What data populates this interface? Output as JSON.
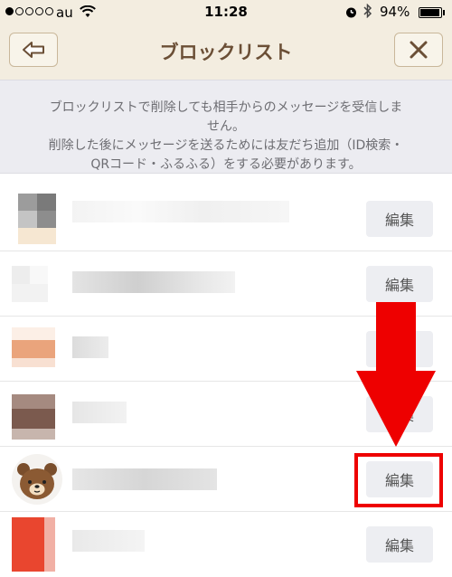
{
  "status_bar": {
    "carrier": "au",
    "time": "11:28",
    "battery_percent": "94%",
    "battery_level": 0.94
  },
  "header": {
    "title": "ブロックリスト"
  },
  "notice": {
    "line1": "ブロックリストで削除しても相手からのメッセージを受信しま",
    "line2": "せん。",
    "line3": "削除した後にメッセージを送るためには友だち追加（ID検索・",
    "line4": "QRコード・ふるふる）をする必要があります。"
  },
  "list": {
    "edit_label": "編集",
    "items": [
      {
        "name": ""
      },
      {
        "name": ""
      },
      {
        "name": ""
      },
      {
        "name": ""
      },
      {
        "name": ""
      },
      {
        "name": ""
      }
    ]
  },
  "colors": {
    "header_bg": "#f3ede0",
    "title": "#6b4f36",
    "annotation": "#ee0000"
  }
}
